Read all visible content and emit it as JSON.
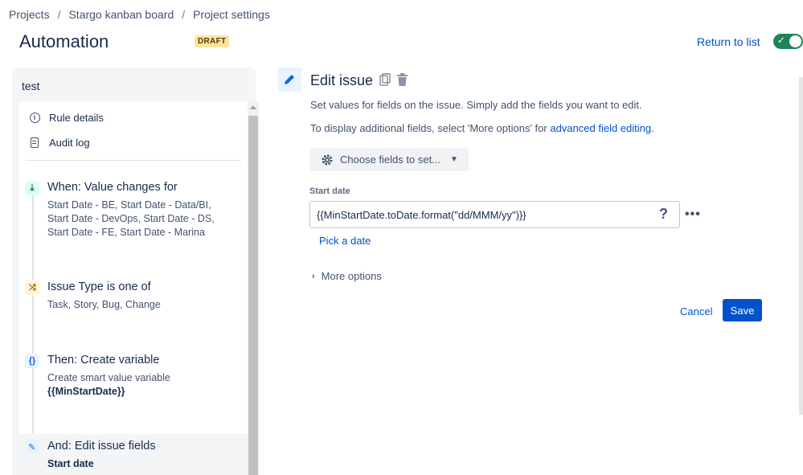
{
  "breadcrumb": {
    "items": [
      "Projects",
      "Stargo kanban board",
      "Project settings"
    ],
    "separator": "/"
  },
  "header": {
    "title": "Automation",
    "badge": "DRAFT",
    "return_link": "Return to list",
    "toggle_state": "enabled",
    "toggle_check": "✓"
  },
  "rule": {
    "name": "test",
    "nav": [
      {
        "label": "Rule details",
        "icon": "info-icon"
      },
      {
        "label": "Audit log",
        "icon": "log-icon"
      }
    ],
    "steps": [
      {
        "type": "trigger",
        "icon": "trigger-icon",
        "icon_glyph": "⤓",
        "title": "When: Value changes for",
        "desc": "Start Date - BE, Start Date - Data/BI, Start Date - DevOps, Start Date - DS, Start Date - FE, Start Date - Marina"
      },
      {
        "type": "condition",
        "icon": "shuffle-icon",
        "icon_glyph": "⤨",
        "title": "Issue Type is one of",
        "desc": "Task, Story, Bug, Change"
      },
      {
        "type": "action",
        "icon": "braces-icon",
        "icon_glyph": "{}",
        "title": "Then: Create variable",
        "desc": "Create smart value variable",
        "strong": "{{MinStartDate}}"
      },
      {
        "type": "action",
        "icon": "pencil-icon",
        "icon_glyph": "✎",
        "title": "And: Edit issue fields",
        "strong": "Start date",
        "selected": true
      }
    ]
  },
  "editor": {
    "title": "Edit issue",
    "desc1": "Set values for fields on the issue. Simply add the fields you want to edit.",
    "desc2_prefix": "To display additional fields, select 'More options' for ",
    "desc2_link": "advanced field editing",
    "desc2_suffix": ".",
    "choose_fields": "Choose fields to set...",
    "field_label": "Start date",
    "field_value": "{{MinStartDate.toDate.format(\"dd/MMM/yy\")}}",
    "help_glyph": "?",
    "more_glyph": "•••",
    "pick_date": "Pick a date",
    "more_options": "More options",
    "cancel": "Cancel",
    "save": "Save"
  },
  "colors": {
    "accent": "#0052cc",
    "toggle_on": "#1f845a",
    "draft_badge": "#f8e6a0"
  }
}
